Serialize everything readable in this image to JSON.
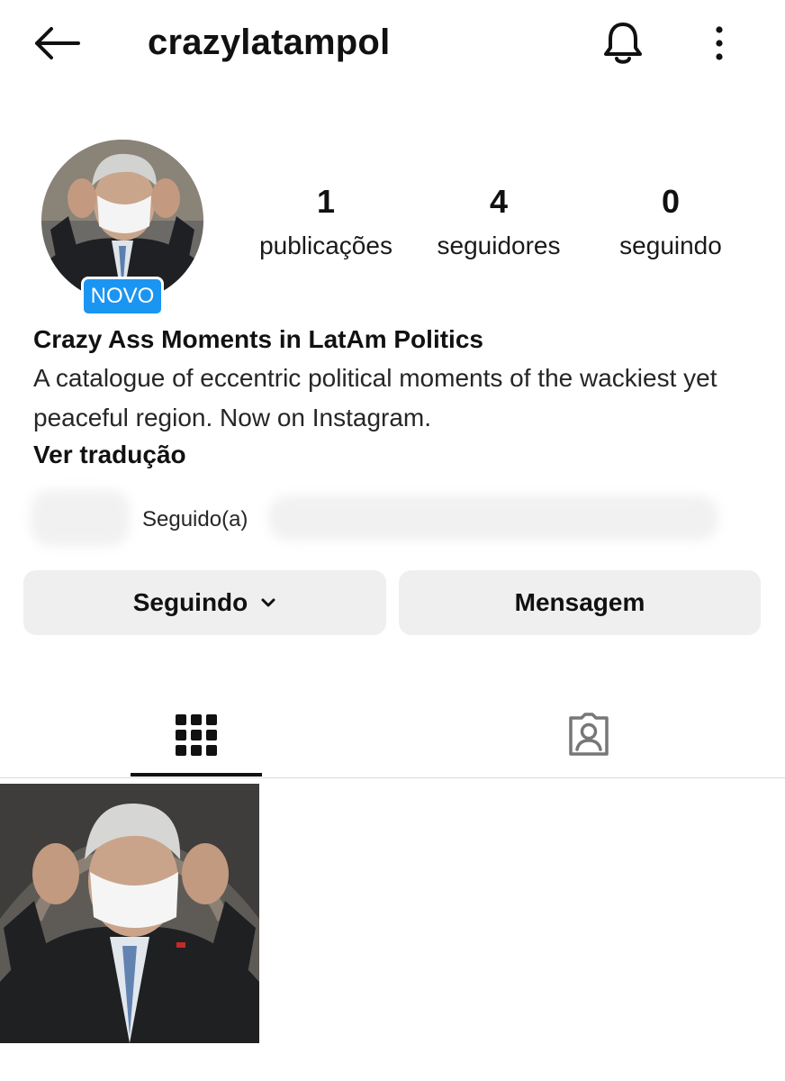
{
  "header": {
    "username": "crazylatampol",
    "back_icon": "arrow-left-icon",
    "bell_icon": "bell-icon",
    "more_icon": "more-vertical-icon"
  },
  "profile": {
    "new_badge": "NOVO",
    "stats": [
      {
        "value": "1",
        "label": "publicações"
      },
      {
        "value": "4",
        "label": "seguidores"
      },
      {
        "value": "0",
        "label": "seguindo"
      }
    ],
    "display_name": "Crazy Ass Moments in LatAm Politics",
    "bio": "A catalogue of eccentric political moments of the wackiest yet peaceful region. Now on Instagram.",
    "translate_label": "Ver tradução",
    "followed_by_label": "Seguido(a)"
  },
  "actions": {
    "following_label": "Seguindo",
    "message_label": "Mensagem"
  },
  "tabs": [
    {
      "icon": "grid-icon",
      "active": true
    },
    {
      "icon": "tagged-person-icon",
      "active": false
    }
  ],
  "colors": {
    "accent": "#1b95f2",
    "button_bg": "#efeff0",
    "text": "#111111"
  }
}
